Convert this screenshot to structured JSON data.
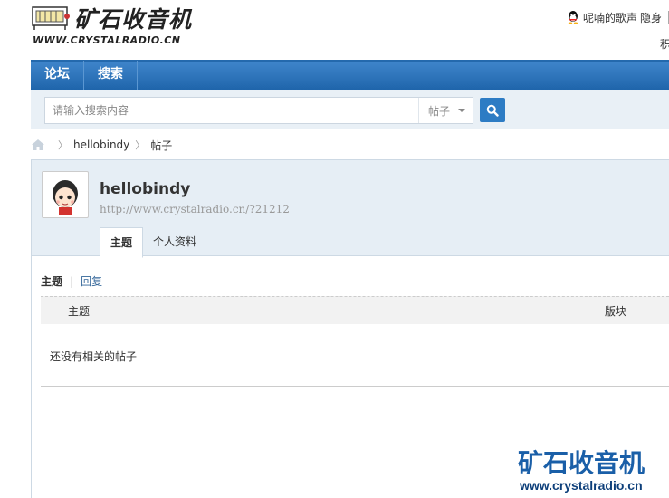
{
  "header": {
    "logo_cn": "矿石收音机",
    "logo_url": "WWW.CRYSTALRADIO.CN",
    "user": {
      "name": "呢喃的歌声",
      "status": "隐身",
      "extra": "积"
    }
  },
  "nav": {
    "items": [
      "论坛",
      "搜索"
    ]
  },
  "search": {
    "placeholder": "请输入搜索内容",
    "type": "帖子"
  },
  "breadcrumb": {
    "items": [
      "hellobindy",
      "帖子"
    ]
  },
  "profile": {
    "name": "hellobindy",
    "url": "http://www.crystalradio.cn/?21212",
    "tabs": [
      "主题",
      "个人资料"
    ],
    "active_tab": "主题"
  },
  "content": {
    "subtabs": [
      "主题",
      "回复"
    ],
    "columns": [
      "主题",
      "版块"
    ],
    "empty_message": "还没有相关的帖子"
  },
  "watermark": {
    "cn": "矿石收音机",
    "url": "www.crystalradio.cn"
  },
  "colors": {
    "nav_blue": "#2d78bf",
    "search_bg": "#e9f0f6",
    "profile_bg": "#e6eef5",
    "link": "#336699",
    "watermark_blue": "#1a5fa8"
  }
}
